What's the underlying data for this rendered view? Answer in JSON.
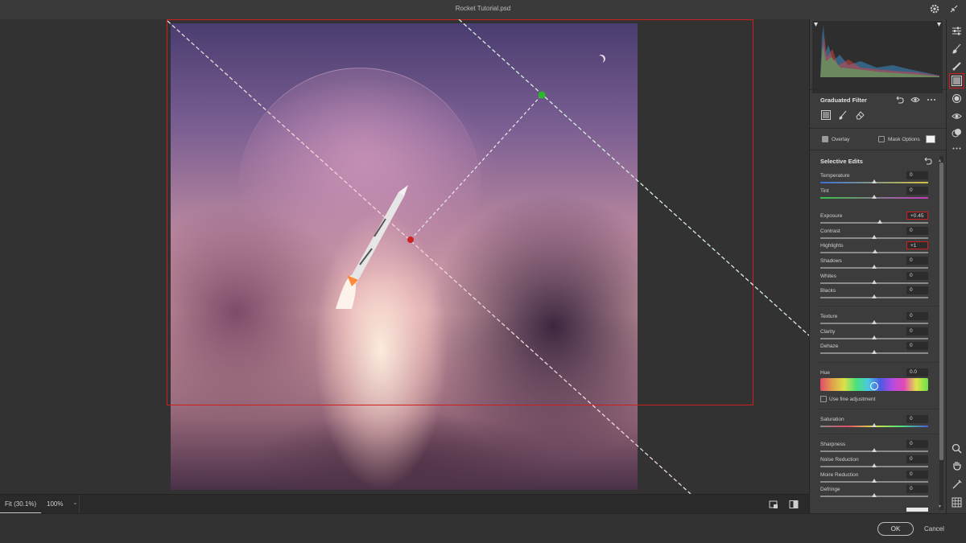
{
  "window": {
    "title": "Rocket Tutorial.psd"
  },
  "colors": {
    "accent_red": "#d01e1e",
    "mask_green": "#2db52d",
    "mask_red": "#cc2222",
    "panel_bg": "#3c3c3c"
  },
  "statusbar": {
    "zoom_fit": "Fit (30.1%)",
    "zoom_100": "100%"
  },
  "footer": {
    "ok": "OK",
    "cancel": "Cancel"
  },
  "panel": {
    "tool_title": "Graduated Filter",
    "overlay_label": "Overlay",
    "overlay_checked": true,
    "mask_options_label": "Mask Options",
    "mask_options_checked": false,
    "selective_edits_title": "Selective Edits",
    "sliders": [
      {
        "label": "Temperature",
        "value": "0"
      },
      {
        "label": "Tint",
        "value": "0"
      },
      {
        "label": "Exposure",
        "value": "+0.45"
      },
      {
        "label": "Contrast",
        "value": "0"
      },
      {
        "label": "Highlights",
        "value": "+1"
      },
      {
        "label": "Shadows",
        "value": "0"
      },
      {
        "label": "Whites",
        "value": "0"
      },
      {
        "label": "Blacks",
        "value": "0"
      },
      {
        "label": "Texture",
        "value": "0"
      },
      {
        "label": "Clarity",
        "value": "0"
      },
      {
        "label": "Dehaze",
        "value": "0"
      }
    ],
    "hue": {
      "label": "Hue",
      "value": "0.0"
    },
    "fine_adjustment_label": "Use fine adjustment",
    "saturation": {
      "label": "Saturation",
      "value": "0"
    },
    "detail": [
      {
        "label": "Sharpness",
        "value": "0"
      },
      {
        "label": "Noise Reduction",
        "value": "0"
      },
      {
        "label": "Moire Reduction",
        "value": "0"
      },
      {
        "label": "Defringe",
        "value": "0"
      }
    ]
  },
  "tools": [
    "sliders-icon",
    "brush-icon",
    "spot-removal-icon",
    "graduated-filter-icon",
    "radial-filter-icon",
    "red-eye-icon",
    "presets-icon",
    "more-icon",
    "zoom-icon",
    "hand-icon",
    "color-sampler-icon",
    "grid-icon"
  ]
}
